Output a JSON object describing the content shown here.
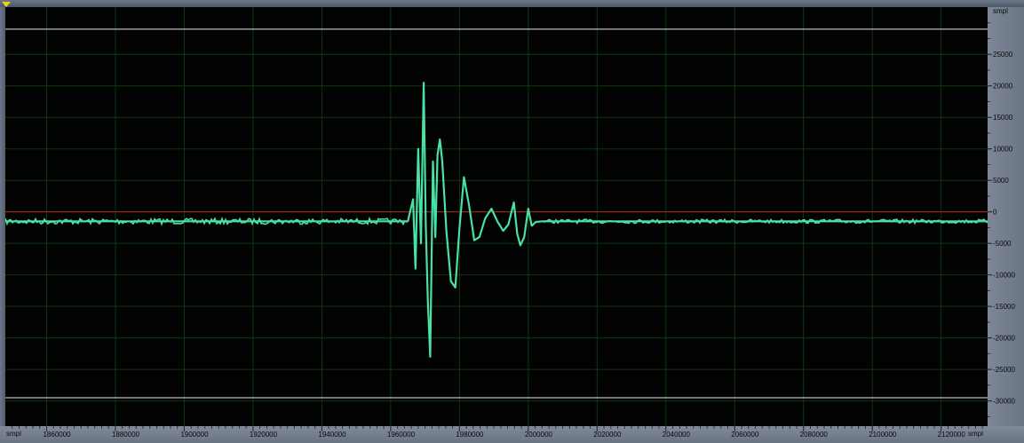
{
  "editor": {
    "unit_label_y": "smpl",
    "unit_label_x_left": "smpl",
    "unit_label_x_right": "smpl",
    "playhead_marker_icon": "playhead-triangle-icon",
    "colors": {
      "background": "#020202",
      "grid": "#0d3a0d",
      "waveform": "#4be0a4",
      "zero_line": "#a52a2a",
      "clip_lines": "#e8e8e8",
      "ruler": "#76808f",
      "playhead": "#e8d21b"
    }
  },
  "chart_data": {
    "type": "line",
    "title": "",
    "xlabel": "smpl",
    "ylabel": "smpl",
    "xlim": [
      1848000,
      2133500
    ],
    "ylim": [
      -34000,
      32500
    ],
    "x_ticks": [
      1860000,
      1880000,
      1900000,
      1920000,
      1940000,
      1960000,
      1980000,
      2000000,
      2020000,
      2040000,
      2060000,
      2080000,
      2100000,
      2120000
    ],
    "y_ticks": [
      25000,
      20000,
      15000,
      10000,
      5000,
      0,
      -5000,
      -10000,
      -15000,
      -20000,
      -25000,
      -30000
    ],
    "zero_line": 0,
    "clip_lines": [
      29000,
      -29500
    ],
    "grid": true,
    "series": [
      {
        "x": [
          1848000,
          1900000,
          1965000,
          1966500,
          1967200,
          1968000,
          1968800,
          1969600,
          1970200,
          1970800,
          1971500,
          1972300,
          1973000,
          1973600,
          1974300,
          1975000,
          1976200,
          1977500,
          1978800,
          1980000,
          1981300,
          1982800,
          1984300,
          1985800,
          1987500,
          1989300,
          1991000,
          1992700,
          1994200,
          1995800,
          1996800,
          1997700,
          1998800,
          2000000,
          2001000,
          2002200,
          2004000,
          2008000,
          2020000,
          2133500
        ],
        "y": [
          -1500,
          -1500,
          -1500,
          2000,
          -9000,
          10000,
          -5000,
          20500,
          -2000,
          -14000,
          -23000,
          8000,
          -4000,
          9000,
          11500,
          8000,
          -3000,
          -11000,
          -12000,
          -2500,
          5500,
          1000,
          -4500,
          -4000,
          -1000,
          500,
          -1500,
          -3000,
          -2000,
          1500,
          -3500,
          -5300,
          -4000,
          500,
          -2200,
          -1600,
          -1500,
          -1500,
          -1500,
          -1500
        ]
      }
    ]
  }
}
